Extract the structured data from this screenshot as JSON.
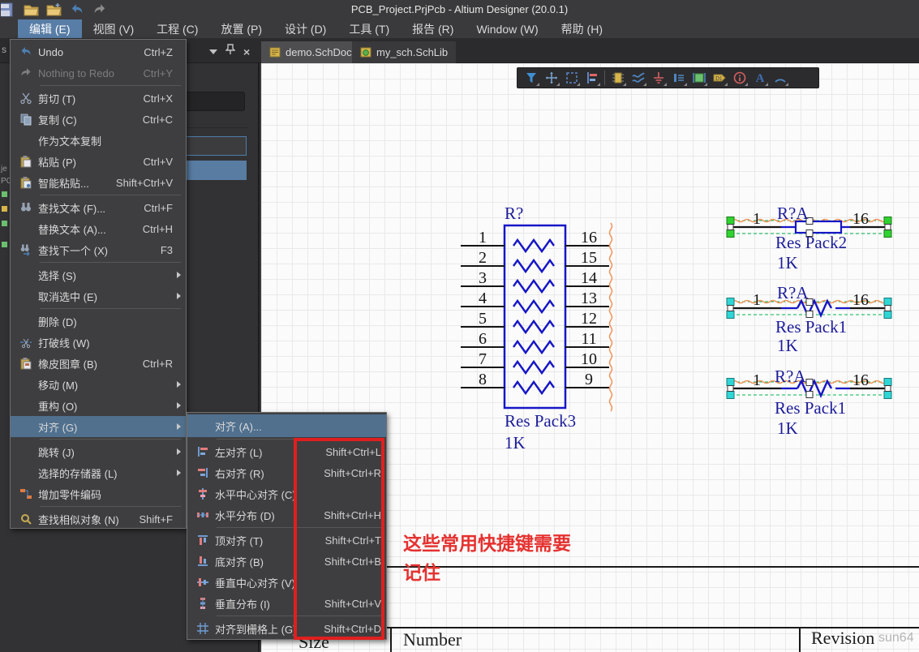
{
  "window": {
    "title": "PCB_Project.PrjPcb - Altium Designer (20.0.1)"
  },
  "quick_access": {
    "icons": [
      "save-icon",
      "open-icon",
      "open-project-icon",
      "undo-icon",
      "redo-icon"
    ]
  },
  "menubar": {
    "items": [
      {
        "label": "编辑 (E)",
        "active": true
      },
      {
        "label": "视图 (V)"
      },
      {
        "label": "工程 (C)"
      },
      {
        "label": "放置 (P)"
      },
      {
        "label": "设计 (D)"
      },
      {
        "label": "工具 (T)"
      },
      {
        "label": "报告 (R)"
      },
      {
        "label": "Window (W)"
      },
      {
        "label": "帮助 (H)"
      }
    ]
  },
  "tabs": [
    {
      "label": "demo.SchDoc *",
      "active": true
    },
    {
      "label": "my_sch.SchLib",
      "active": false
    }
  ],
  "panel": {
    "buttons": [
      "collapse",
      "pin",
      "close"
    ],
    "edge_fragments": {
      "f1": "s",
      "f2": "je",
      "f3": "PC"
    }
  },
  "edit_menu": {
    "items": [
      {
        "label": "Undo",
        "shortcut": "Ctrl+Z"
      },
      {
        "label": "Nothing to Redo",
        "shortcut": "Ctrl+Y",
        "disabled": true
      },
      {
        "label": "剪切 (T)",
        "shortcut": "Ctrl+X"
      },
      {
        "label": "复制 (C)",
        "shortcut": "Ctrl+C"
      },
      {
        "label": "作为文本复制",
        "shortcut": ""
      },
      {
        "label": "粘贴 (P)",
        "shortcut": "Ctrl+V"
      },
      {
        "label": "智能粘贴...",
        "shortcut": "Shift+Ctrl+V"
      },
      {
        "label": "查找文本 (F)...",
        "shortcut": "Ctrl+F"
      },
      {
        "label": "替换文本 (A)...",
        "shortcut": "Ctrl+H"
      },
      {
        "label": "查找下一个 (X)",
        "shortcut": "F3"
      },
      {
        "label": "选择 (S)",
        "shortcut": "",
        "submenu": true
      },
      {
        "label": "取消选中 (E)",
        "shortcut": "",
        "submenu": true
      },
      {
        "label": "删除 (D)",
        "shortcut": ""
      },
      {
        "label": "打破线 (W)",
        "shortcut": ""
      },
      {
        "label": "橡皮图章 (B)",
        "shortcut": "Ctrl+R"
      },
      {
        "label": "移动 (M)",
        "shortcut": "",
        "submenu": true
      },
      {
        "label": "重构 (O)",
        "shortcut": "",
        "submenu": true
      },
      {
        "label": "对齐 (G)",
        "shortcut": "",
        "submenu": true,
        "highlighted": true
      },
      {
        "label": "跳转 (J)",
        "shortcut": "",
        "submenu": true
      },
      {
        "label": "选择的存储器 (L)",
        "shortcut": "",
        "submenu": true
      },
      {
        "label": "增加零件编码",
        "shortcut": ""
      },
      {
        "label": "查找相似对象 (N)",
        "shortcut": "Shift+F"
      }
    ]
  },
  "align_submenu": {
    "items": [
      {
        "label": "对齐 (A)...",
        "shortcut": "",
        "highlighted": true
      },
      {
        "label": "左对齐 (L)",
        "shortcut": "Shift+Ctrl+L"
      },
      {
        "label": "右对齐 (R)",
        "shortcut": "Shift+Ctrl+R"
      },
      {
        "label": "水平中心对齐 (C)",
        "shortcut": ""
      },
      {
        "label": "水平分布 (D)",
        "shortcut": "Shift+Ctrl+H"
      },
      {
        "label": "顶对齐 (T)",
        "shortcut": "Shift+Ctrl+T"
      },
      {
        "label": "底对齐 (B)",
        "shortcut": "Shift+Ctrl+B"
      },
      {
        "label": "垂直中心对齐 (V)",
        "shortcut": ""
      },
      {
        "label": "垂直分布 (I)",
        "shortcut": "Shift+Ctrl+V"
      },
      {
        "label": "对齐到栅格上 (G)",
        "shortcut": "Shift+Ctrl+D"
      }
    ]
  },
  "active_bar": {
    "icons": [
      "filter-icon",
      "move-icon",
      "select-area-icon",
      "align-icon",
      "place-part-icon",
      "place-wire-icon",
      "place-power-port-icon",
      "place-pin-icon",
      "place-part-body-icon",
      "place-net-label-icon",
      "place-no-erc-icon",
      "place-text-icon",
      "place-arc-icon"
    ]
  },
  "annotation": {
    "line1": "这些常用快捷键需要",
    "line2": "记住"
  },
  "schematic": {
    "respack3": {
      "designator": "R?",
      "comment": "Res Pack3",
      "value": "1K",
      "left_pins": [
        "1",
        "2",
        "3",
        "4",
        "5",
        "6",
        "7",
        "8"
      ],
      "right_pins": [
        "16",
        "15",
        "14",
        "13",
        "12",
        "11",
        "10",
        "9"
      ]
    },
    "components": [
      {
        "designator": "R?A",
        "comment": "Res Pack2",
        "value": "1K",
        "pin_left": "1",
        "pin_right": "16"
      },
      {
        "designator": "R?A",
        "comment": "Res Pack1",
        "value": "1K",
        "pin_left": "1",
        "pin_right": "16"
      },
      {
        "designator": "R?A",
        "comment": "Res Pack1",
        "value": "1K",
        "pin_left": "1",
        "pin_right": "16"
      }
    ]
  },
  "title_block": {
    "size_label": "Size",
    "number_label": "Number",
    "revision_label": "Revision",
    "watermark": "sun64"
  },
  "colors": {
    "menu_highlight": "#50708e",
    "menubar_highlight": "#587da6",
    "annotation_red": "#e01f1f",
    "schematic_blue": "#1616c8",
    "label_navy": "#1c1c9a",
    "error_orange": "#ef9760",
    "handle_green": "#2fd32f",
    "handle_cyan": "#2fd6d6",
    "selection_green": "#00b44c"
  }
}
